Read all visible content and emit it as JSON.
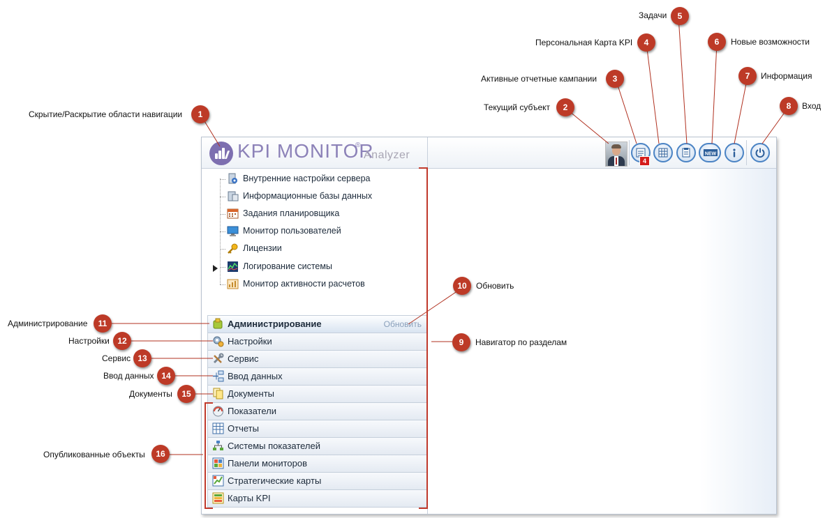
{
  "app": {
    "logo_text": "KPI MONITOR",
    "logo_reg": "®",
    "logo_sub": "Analyzer",
    "kpi_badge": "4"
  },
  "header_buttons": [
    {
      "id": "current-subject",
      "icon": "avatar-icon"
    },
    {
      "id": "active-campaigns",
      "icon": "report-campaign-icon"
    },
    {
      "id": "personal-kpi-map",
      "icon": "kpi-map-icon"
    },
    {
      "id": "tasks",
      "icon": "tasks-icon"
    },
    {
      "id": "new-features",
      "icon": "new-badge-icon"
    },
    {
      "id": "information",
      "icon": "info-icon"
    },
    {
      "id": "login",
      "icon": "power-icon"
    }
  ],
  "tree": {
    "items": [
      {
        "label": "Внутренние настройки сервера",
        "icon": "server-settings-icon"
      },
      {
        "label": "Информационные базы данных",
        "icon": "database-icon"
      },
      {
        "label": "Задания планировщика",
        "icon": "calendar-icon"
      },
      {
        "label": "Монитор пользователей",
        "icon": "monitor-icon"
      },
      {
        "label": "Лицензии",
        "icon": "key-icon"
      },
      {
        "label": "Логирование системы",
        "icon": "log-icon"
      },
      {
        "label": "Монитор активности расчетов",
        "icon": "activity-icon"
      }
    ]
  },
  "sections": {
    "refresh_label": "Обновить",
    "items": [
      {
        "label": "Администрирование",
        "icon": "admin-icon",
        "active": true
      },
      {
        "label": "Настройки",
        "icon": "settings-icon"
      },
      {
        "label": "Сервис",
        "icon": "service-icon"
      },
      {
        "label": "Ввод данных",
        "icon": "data-entry-icon"
      },
      {
        "label": "Документы",
        "icon": "documents-icon"
      },
      {
        "label": "Показатели",
        "icon": "indicators-icon"
      },
      {
        "label": "Отчеты",
        "icon": "reports-icon"
      },
      {
        "label": "Системы показателей",
        "icon": "indicator-systems-icon"
      },
      {
        "label": "Панели мониторов",
        "icon": "dashboards-icon"
      },
      {
        "label": "Стратегические карты",
        "icon": "strategy-maps-icon"
      },
      {
        "label": "Карты KPI",
        "icon": "kpi-maps-icon"
      }
    ]
  },
  "annotations": [
    {
      "n": "1",
      "label": "Скрытие/Раскрытие области навигации"
    },
    {
      "n": "2",
      "label": "Текущий субъект"
    },
    {
      "n": "3",
      "label": "Активные отчетные кампании"
    },
    {
      "n": "4",
      "label": "Персональная Карта KPI"
    },
    {
      "n": "5",
      "label": "Задачи"
    },
    {
      "n": "6",
      "label": "Новые возможности"
    },
    {
      "n": "7",
      "label": "Информация"
    },
    {
      "n": "8",
      "label": "Вход"
    },
    {
      "n": "9",
      "label": "Навигатор по разделам"
    },
    {
      "n": "10",
      "label": "Обновить"
    },
    {
      "n": "11",
      "label": "Администрирование"
    },
    {
      "n": "12",
      "label": "Настройки"
    },
    {
      "n": "13",
      "label": "Сервис"
    },
    {
      "n": "14",
      "label": "Ввод данных"
    },
    {
      "n": "15",
      "label": "Документы"
    },
    {
      "n": "16",
      "label": "Опубликованные объекты"
    }
  ],
  "colors": {
    "badge": "#bd3a27",
    "accent": "#4a83c4",
    "logo": "#8c82b8",
    "bracket": "#c0392b"
  }
}
